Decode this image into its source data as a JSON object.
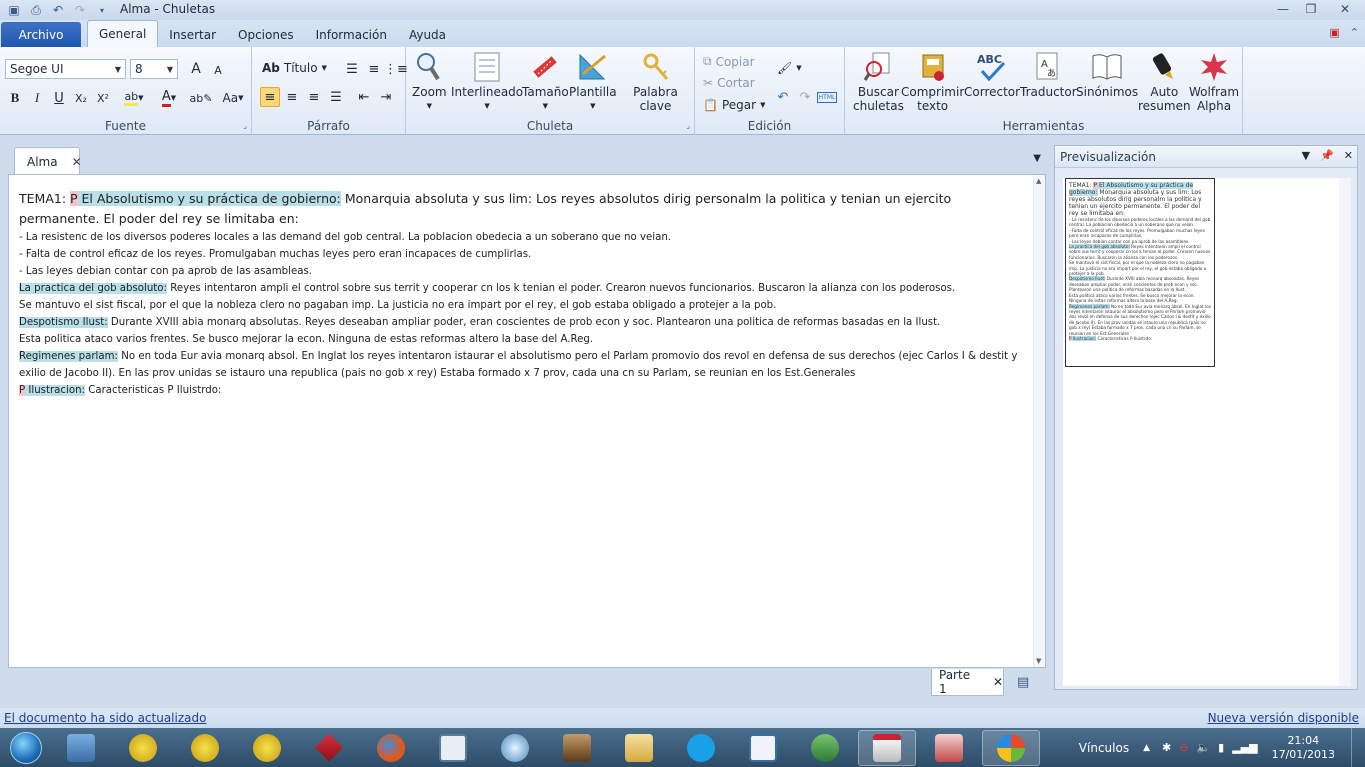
{
  "window": {
    "title": "Alma - Chuletas"
  },
  "tabs": {
    "archivo": "Archivo",
    "items": [
      "General",
      "Insertar",
      "Opciones",
      "Información",
      "Ayuda"
    ]
  },
  "ribbon": {
    "fuente": {
      "label": "Fuente",
      "font_name": "Segoe UI",
      "font_size": "8",
      "grow": "A",
      "shrink": "A",
      "bold": "B",
      "italic": "I",
      "underline": "U",
      "sub": "X₂",
      "sup": "X²",
      "change_case": "Aa"
    },
    "parrafo": {
      "label": "Párrafo",
      "style": "Título"
    },
    "chuleta": {
      "label": "Chuleta",
      "buttons": [
        "Zoom",
        "Interlineado",
        "Tamaño",
        "Plantilla",
        "Palabra clave"
      ]
    },
    "edicion": {
      "label": "Edición",
      "copiar": "Copiar",
      "cortar": "Cortar",
      "pegar": "Pegar"
    },
    "herramientas": {
      "label": "Herramientas",
      "buttons": [
        {
          "line1": "Buscar",
          "line2": "chuletas"
        },
        {
          "line1": "Comprimir",
          "line2": "texto"
        },
        {
          "line1": "Corrector",
          "line2": ""
        },
        {
          "line1": "Traductor",
          "line2": ""
        },
        {
          "line1": "Sinónimos",
          "line2": ""
        },
        {
          "line1": "Auto",
          "line2": "resumen"
        },
        {
          "line1": "Wolfram",
          "line2": "Alpha"
        }
      ]
    }
  },
  "document": {
    "tab": "Alma",
    "part_tab": "Parte 1",
    "lines": [
      {
        "pre": "TEMA1: ",
        "pink": "P",
        "hl": " El Absolutismo y su práctica de gobierno:",
        "text": " Monarquia absoluta y sus lim: Los reyes absolutos dirig personalm la politica y tenian un ejercito permanente. El poder del rey se limitaba en:"
      },
      {
        "text": "- La resistenc de los diversos poderes locales a las demand del gob central. La poblacion obedecia a un soberano que no veian."
      },
      {
        "text": "- Falta de control eficaz de los reyes. Promulgaban muchas leyes pero eran incapaces de cumplirlas."
      },
      {
        "text": "- Las leyes debian contar con pa aprob de las asambleas."
      },
      {
        "hl": "La practica del gob absoluto:",
        "text": " Reyes intentaron ampli el control sobre sus territ y cooperar cn los k tenian el poder. Crearon nuevos funcionarios. Buscaron la alianza con los poderosos."
      },
      {
        "text": "Se mantuvo el sist fiscal, por el que la nobleza  clero no pagaban imp. La justicia no era impart por el rey, el gob estaba obligado a protejer a la pob."
      },
      {
        "hl": "Despotismo Ilust:",
        "text": " Durante XVIII abia monarq absolutas. Reyes deseaban ampliar poder, eran coscientes de prob econ y soc. Plantearon una politica de reformas basadas en la Ilust."
      },
      {
        "text": "Esta politica ataco varios frentes. Se busco mejorar la econ. Ninguna de estas reformas altero la base del A.Reg."
      },
      {
        "hl": "Regimenes parlam:",
        "text": " No en toda Eur avia monarq absol. En Inglat los reyes intentaron istaurar el absolutismo pero el Parlam promovio dos revol en defensa de sus derechos (ejec Carlos I & destit y exilio de Jacobo II). En las prov unidas se istauro una republica (pais no gob x rey) Estaba formado x 7 prov, cada una cn su Parlam, se reunian en los Est.Generales"
      },
      {
        "pink": "P",
        "hl": " Ilustracion:",
        "text": " Caracteristicas P Iluistrdo:"
      }
    ]
  },
  "preview": {
    "title": "Previsualización"
  },
  "status": {
    "left": "El documento ha sido actualizado",
    "right": "Nueva versión disponible"
  },
  "taskbar": {
    "vinculos": "Vínculos",
    "time": "21:04",
    "date": "17/01/2013"
  },
  "colors": {
    "highlight": "#b9dfe9",
    "pink": "#f7c2c9",
    "archivo": "#2a62b8"
  }
}
